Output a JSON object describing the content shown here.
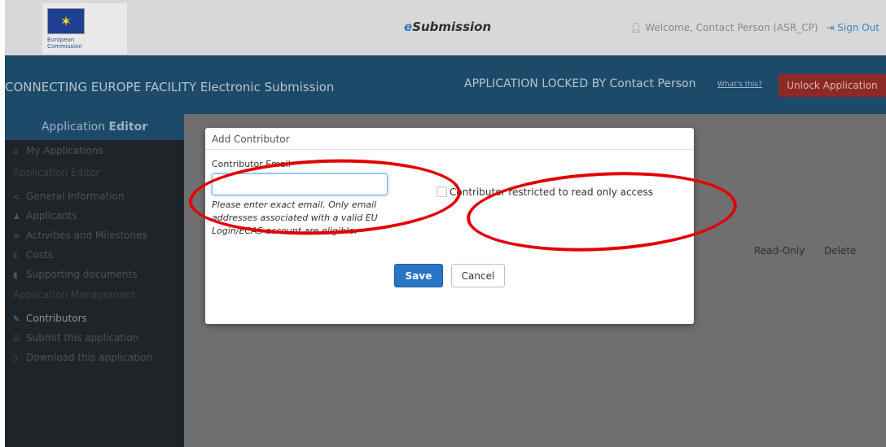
{
  "header": {
    "logo_line1": "European",
    "logo_line2": "Commission",
    "app_prefix": "e",
    "app_name": "Submission",
    "welcome": "Welcome, Contact Person (ASR_CP)",
    "sign_out": "Sign Out"
  },
  "banner": {
    "project_title": "CONNECTING EUROPE FACILITY Electronic Submission",
    "lock_status": "APPLICATION LOCKED BY Contact Person",
    "whats_this": "What's this?",
    "unlock_button": "Unlock Application"
  },
  "sidebar": {
    "heading_part1": "Application ",
    "heading_part2": "Editor",
    "my_applications": "My Applications",
    "section_editor": "Application Editor",
    "items": [
      {
        "label": "General Information",
        "icon": "share-icon"
      },
      {
        "label": "Applicants",
        "icon": "users-icon"
      },
      {
        "label": "Activities and Milestones",
        "icon": "list-icon"
      },
      {
        "label": "Costs",
        "icon": "euro-icon"
      },
      {
        "label": "Supporting documents",
        "icon": "document-icon"
      }
    ],
    "section_management": "Application Management",
    "management_items": [
      {
        "label": "Contributors",
        "icon": "pencil-icon"
      },
      {
        "label": "Submit this application",
        "icon": "checkbox-icon"
      },
      {
        "label": "Download this application",
        "icon": "file-icon"
      }
    ]
  },
  "table": {
    "col_read_only": "Read-Only",
    "col_delete": "Delete"
  },
  "modal": {
    "title": "Add Contributor",
    "email_label": "Contributor Email",
    "email_value": "",
    "help_text": "Please enter exact email. Only email addresses associated with a valid EU Login/ECAS account are eligible.",
    "readonly_label": "Contributor restricted to read only access",
    "readonly_checked": false,
    "save_button": "Save",
    "cancel_button": "Cancel"
  },
  "colors": {
    "banner": "#1d4a69",
    "unlock": "#8e2a26",
    "save": "#2a74c4",
    "annotation": "#e30000"
  }
}
